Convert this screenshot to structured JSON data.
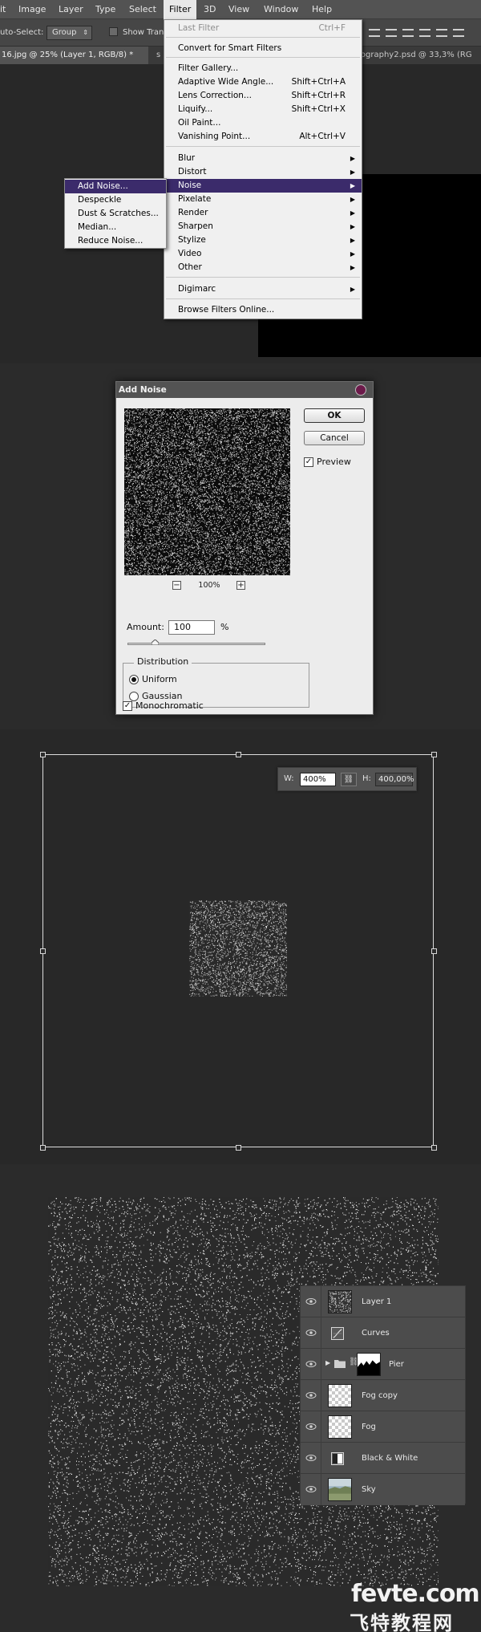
{
  "menubar": {
    "items": [
      "it",
      "Image",
      "Layer",
      "Type",
      "Select",
      "Filter",
      "3D",
      "View",
      "Window",
      "Help"
    ],
    "active": "Filter"
  },
  "options_bar": {
    "auto_select_label": "uto-Select:",
    "group_value": "Group",
    "show_transform_label": "Show Tran"
  },
  "tabs": {
    "tab1": "16.jpg @ 25% (Layer 1, RGB/8) *",
    "tab2": "s",
    "tab3": "tography2.psd @ 33,3% (RG"
  },
  "filter_menu": {
    "items": [
      {
        "label": "Last Filter",
        "shortcut": "Ctrl+F",
        "disabled": true
      },
      {
        "label": "Convert for Smart Filters"
      },
      {
        "label": "Filter Gallery..."
      },
      {
        "label": "Adaptive Wide Angle...",
        "shortcut": "Shift+Ctrl+A"
      },
      {
        "label": "Lens Correction...",
        "shortcut": "Shift+Ctrl+R"
      },
      {
        "label": "Liquify...",
        "shortcut": "Shift+Ctrl+X"
      },
      {
        "label": "Oil Paint..."
      },
      {
        "label": "Vanishing Point...",
        "shortcut": "Alt+Ctrl+V"
      },
      {
        "label": "Blur",
        "submenu": true
      },
      {
        "label": "Distort",
        "submenu": true
      },
      {
        "label": "Noise",
        "submenu": true,
        "highlighted": true
      },
      {
        "label": "Pixelate",
        "submenu": true
      },
      {
        "label": "Render",
        "submenu": true
      },
      {
        "label": "Sharpen",
        "submenu": true
      },
      {
        "label": "Stylize",
        "submenu": true
      },
      {
        "label": "Video",
        "submenu": true
      },
      {
        "label": "Other",
        "submenu": true
      },
      {
        "label": "Digimarc",
        "submenu": true
      },
      {
        "label": "Browse Filters Online..."
      }
    ]
  },
  "noise_menu": {
    "items": [
      {
        "label": "Add Noise...",
        "highlighted": true
      },
      {
        "label": "Despeckle"
      },
      {
        "label": "Dust & Scratches..."
      },
      {
        "label": "Median..."
      },
      {
        "label": "Reduce Noise..."
      }
    ]
  },
  "dialog": {
    "title": "Add Noise",
    "ok": "OK",
    "cancel": "Cancel",
    "preview_label": "Preview",
    "preview_checked": true,
    "zoom": "100%",
    "zoom_minus": "−",
    "zoom_plus": "+",
    "amount_label": "Amount:",
    "amount_value": "100",
    "amount_unit": "%",
    "amount_fraction": 0.2,
    "distribution_title": "Distribution",
    "uniform": "Uniform",
    "gaussian": "Gaussian",
    "selected_distribution": "Uniform",
    "monochromatic": "Monochromatic",
    "monochromatic_checked": true
  },
  "transform": {
    "w_label": "W:",
    "w_value": "400%",
    "h_label": "H:",
    "h_value": "400,00%",
    "link_icon": "link-icon"
  },
  "layers": [
    {
      "name": "Layer 1",
      "thumb": "noise"
    },
    {
      "name": "Curves",
      "thumb": "curves-adjustment-icon"
    },
    {
      "name": "Pier",
      "thumb": "group-mask"
    },
    {
      "name": "Fog copy",
      "thumb": "transparent"
    },
    {
      "name": "Fog",
      "thumb": "transparent"
    },
    {
      "name": "Black & White",
      "thumb": "bw-adjustment-icon"
    },
    {
      "name": "Sky",
      "thumb": "photo"
    }
  ],
  "watermark": {
    "line1": "fevte.com",
    "line2": "飞特教程网"
  },
  "colors": {
    "menu_highlight": "#3b2b6b",
    "ps_dark_bg": "#282828",
    "panel_gray": "#535353"
  }
}
